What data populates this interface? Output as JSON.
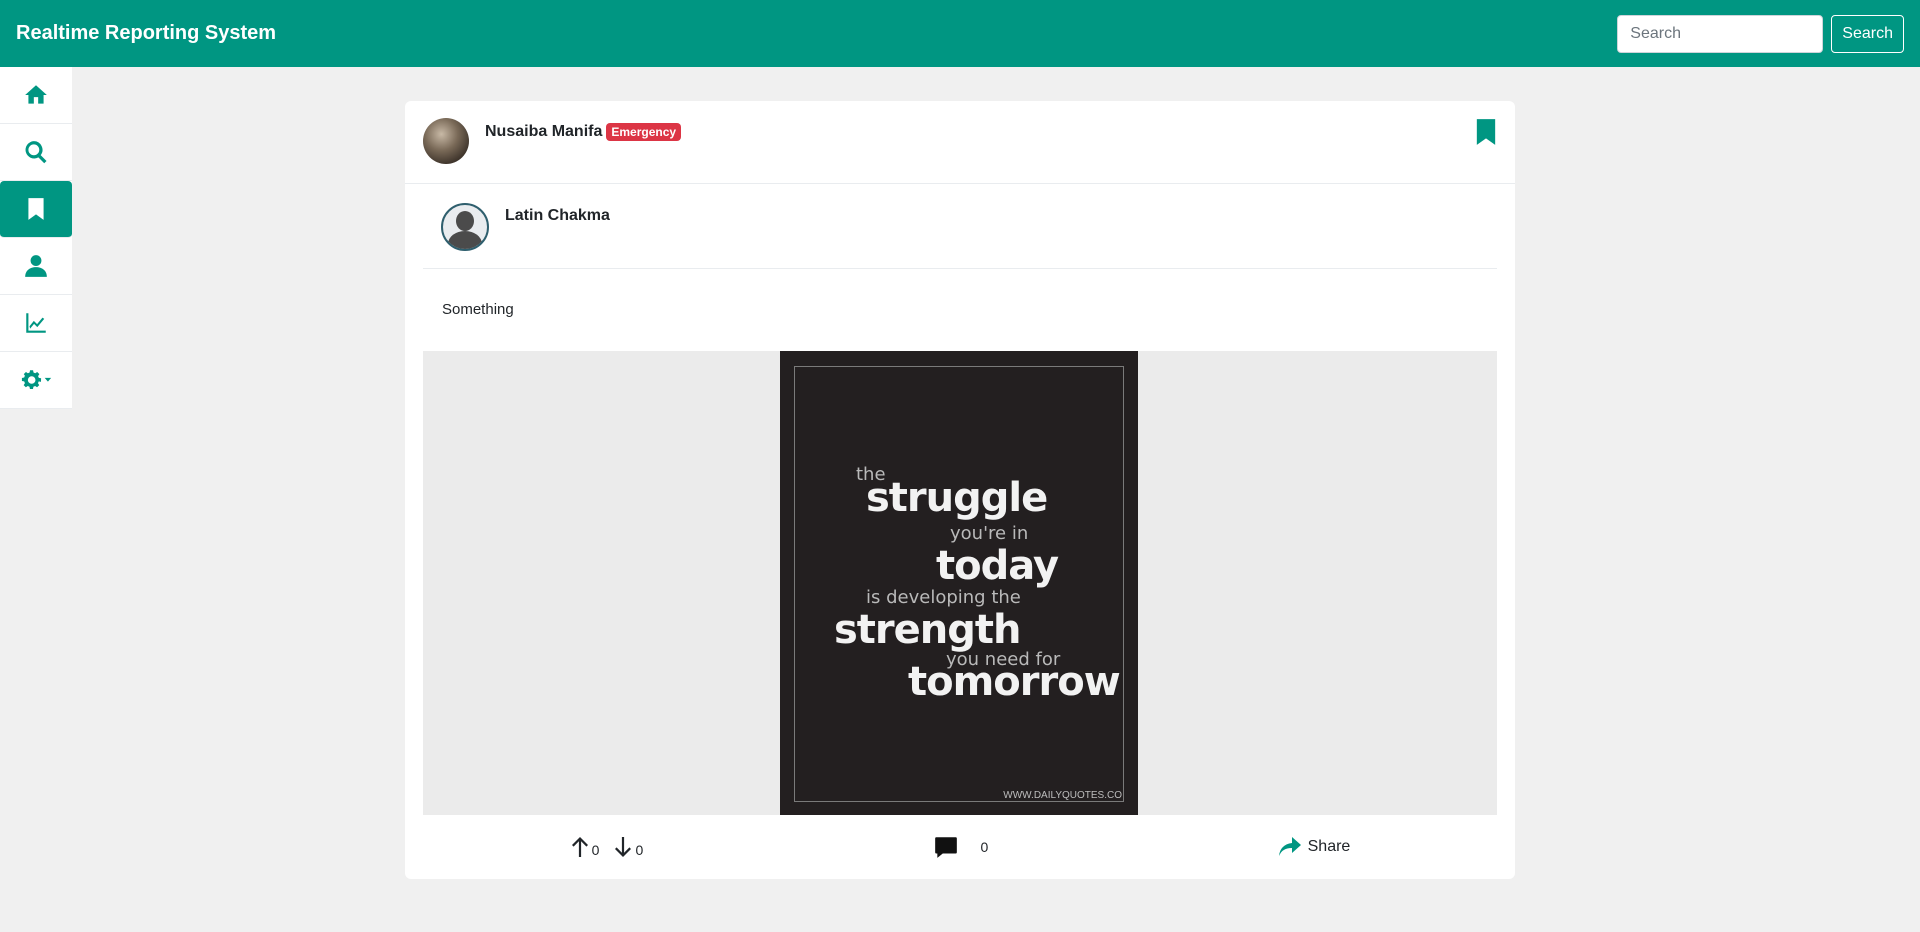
{
  "app": {
    "title": "Realtime Reporting System",
    "accent": "#009682"
  },
  "search": {
    "placeholder": "Search",
    "value": "",
    "button_label": "Search"
  },
  "sidebar": {
    "items": [
      {
        "icon": "home-icon",
        "active": false
      },
      {
        "icon": "search-icon",
        "active": false
      },
      {
        "icon": "bookmark-icon",
        "active": true
      },
      {
        "icon": "user-icon",
        "active": false
      },
      {
        "icon": "chart-line-icon",
        "active": false
      },
      {
        "icon": "gear-icon",
        "active": false
      }
    ]
  },
  "post": {
    "author": "Nusaiba Manifa",
    "badge": "Emergency",
    "badge_color": "#dc3545",
    "sub_author": "Latin Chakma",
    "text": "Something",
    "image_lines": [
      "the",
      "struggle",
      "you're in",
      "today",
      "is developing the",
      "strength",
      "you need for",
      "tomorrow"
    ],
    "image_site": "WWW.DAILYQUOTES.CO",
    "upvotes": "0",
    "downvotes": "0",
    "comments": "0",
    "share_label": "Share"
  }
}
